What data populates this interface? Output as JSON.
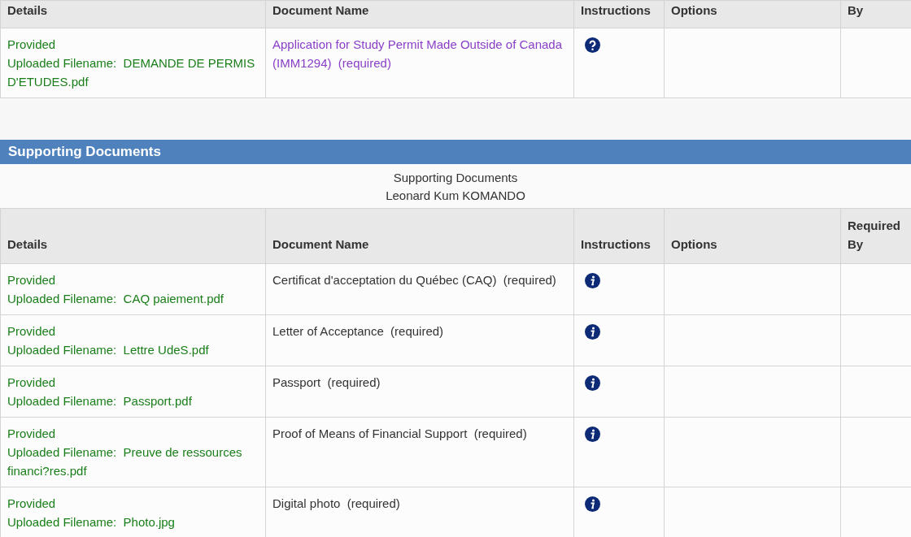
{
  "top_table": {
    "columns": [
      "Details",
      "Document Name",
      "Instructions",
      "Options",
      "By"
    ],
    "rows": [
      {
        "status": "Provided",
        "filename": "Uploaded Filename:  DEMANDE DE PERMIS D'ETUDES.pdf",
        "document": "Application for Study Permit Made Outside of Canada (IMM1294)  (required)",
        "link": true,
        "kind": "question"
      }
    ]
  },
  "section": {
    "title": "Supporting Documents",
    "caption": [
      "Supporting Documents",
      "Leonard Kum KOMANDO"
    ]
  },
  "table": {
    "columns": [
      "Details",
      "Document Name",
      "Instructions",
      "Options",
      "Required By"
    ],
    "rows": [
      {
        "status": "Provided",
        "filename": "Uploaded Filename:  CAQ paiement.pdf",
        "document": "Certificat d'acceptation du Québec (CAQ)  (required)",
        "link": false,
        "kind": "info"
      },
      {
        "status": "Provided",
        "filename": "Uploaded Filename:  Lettre UdeS.pdf",
        "document": "Letter of Acceptance  (required)",
        "link": false,
        "kind": "info"
      },
      {
        "status": "Provided",
        "filename": "Uploaded Filename:  Passport.pdf",
        "document": "Passport  (required)",
        "link": false,
        "kind": "info"
      },
      {
        "status": "Provided",
        "filename": "Uploaded Filename:  Preuve de ressources financi?res.pdf",
        "document": "Proof of Means of Financial Support  (required)",
        "link": false,
        "kind": "info"
      },
      {
        "status": "Provided",
        "filename": "Uploaded Filename:  Photo.jpg",
        "document": "Digital photo  (required)",
        "link": false,
        "kind": "info"
      }
    ]
  }
}
